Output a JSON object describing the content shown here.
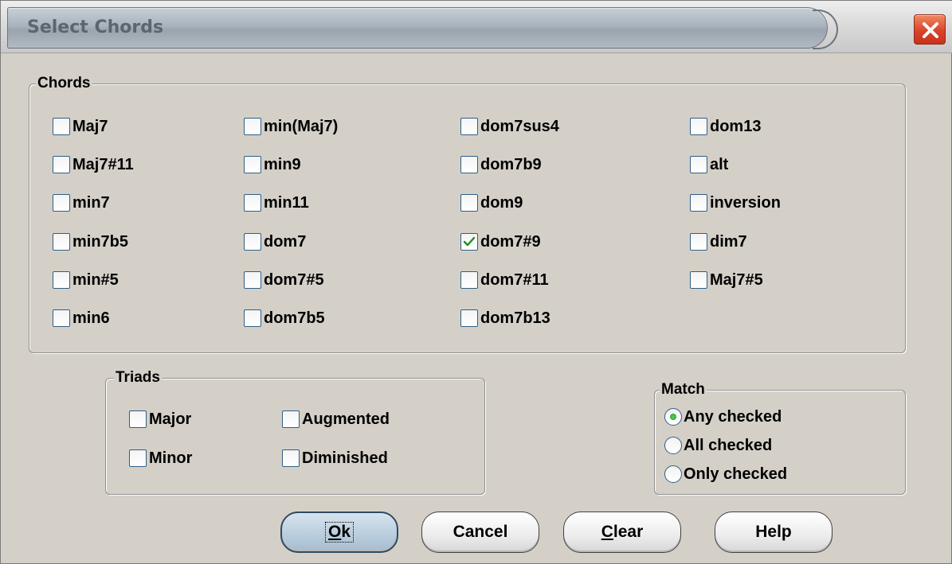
{
  "window": {
    "title": "Select Chords",
    "close_icon": "close-x-icon"
  },
  "chords_group": {
    "label": "Chords",
    "items": [
      {
        "label": "Maj7",
        "checked": false
      },
      {
        "label": "Maj7#11",
        "checked": false
      },
      {
        "label": "min7",
        "checked": false
      },
      {
        "label": "min7b5",
        "checked": false
      },
      {
        "label": "min#5",
        "checked": false
      },
      {
        "label": "min6",
        "checked": false
      },
      {
        "label": "min(Maj7)",
        "checked": false
      },
      {
        "label": "min9",
        "checked": false
      },
      {
        "label": "min11",
        "checked": false
      },
      {
        "label": "dom7",
        "checked": false
      },
      {
        "label": "dom7#5",
        "checked": false
      },
      {
        "label": "dom7b5",
        "checked": false
      },
      {
        "label": "dom7sus4",
        "checked": false
      },
      {
        "label": "dom7b9",
        "checked": false
      },
      {
        "label": "dom9",
        "checked": false
      },
      {
        "label": "dom7#9",
        "checked": true
      },
      {
        "label": "dom7#11",
        "checked": false
      },
      {
        "label": "dom7b13",
        "checked": false
      },
      {
        "label": "dom13",
        "checked": false
      },
      {
        "label": "alt",
        "checked": false
      },
      {
        "label": "inversion",
        "checked": false
      },
      {
        "label": "dim7",
        "checked": false
      },
      {
        "label": "Maj7#5",
        "checked": false
      }
    ]
  },
  "triads_group": {
    "label": "Triads",
    "items": [
      {
        "label": "Major",
        "checked": false
      },
      {
        "label": "Minor",
        "checked": false
      },
      {
        "label": "Augmented",
        "checked": false
      },
      {
        "label": "Diminished",
        "checked": false
      }
    ]
  },
  "match_group": {
    "label": "Match",
    "options": [
      {
        "label": "Any checked",
        "selected": true
      },
      {
        "label": "All checked",
        "selected": false
      },
      {
        "label": "Only checked",
        "selected": false
      }
    ]
  },
  "buttons": {
    "ok": {
      "label_u": "O",
      "label_rest": "k"
    },
    "cancel": {
      "label": "Cancel"
    },
    "clear": {
      "label_u": "C",
      "label_rest": "lear"
    },
    "help": {
      "label": "Help"
    }
  },
  "colors": {
    "dialog_bg": "#d4d0c8",
    "check_mark": "#1f8f1f",
    "close_button": "#d9432a"
  }
}
